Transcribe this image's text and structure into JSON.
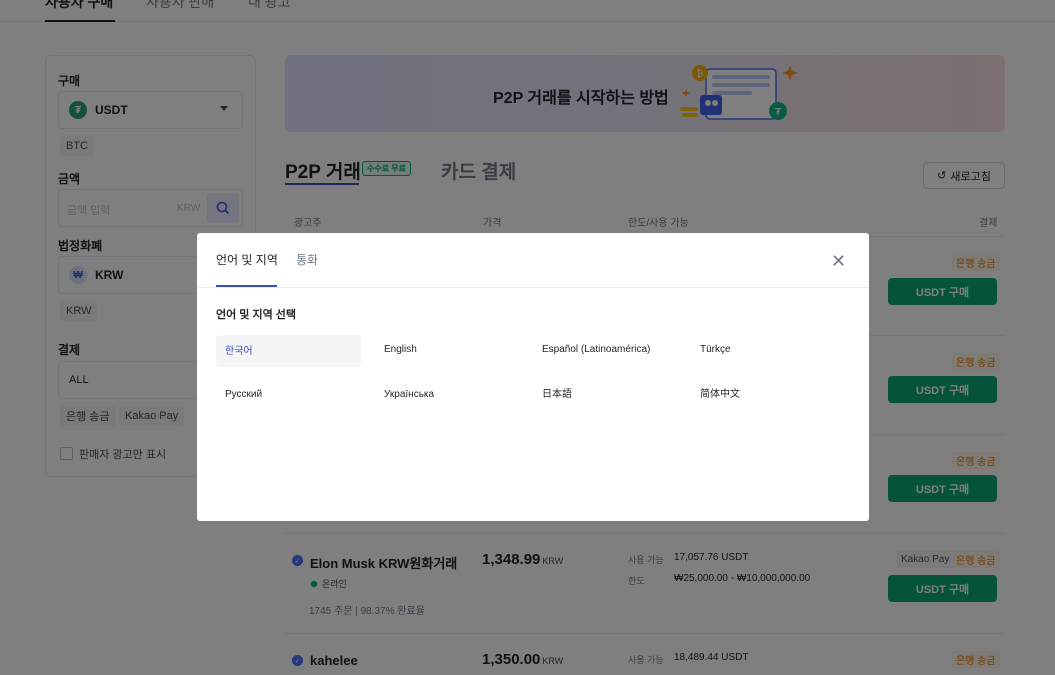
{
  "top_nav": {
    "tabs": [
      "사용자 구매",
      "사용자 판매",
      "내 광고"
    ]
  },
  "sidebar": {
    "buy_label": "구매",
    "buy_asset": "USDT",
    "buy_alt_chip": "BTC",
    "amount_label": "금액",
    "amount_placeholder": "금액 입력",
    "amount_unit": "KRW",
    "fiat_label": "법정화폐",
    "fiat_value": "KRW",
    "fiat_chip": "KRW",
    "payment_label": "결제",
    "payment_value": "ALL",
    "payment_chips": [
      "은행 송금",
      "Kakao Pay"
    ],
    "advertiser_only_label": "판매자 광고만 표시"
  },
  "banner": {
    "text": "P2P 거래를 시작하는 방법"
  },
  "main": {
    "tab_p2p": "P2P 거래",
    "free_badge": "수수료 무료",
    "tab_card": "카드 결제",
    "refresh_label": "새로고침",
    "columns": [
      "광고주",
      "가격",
      "한도/사용 가능",
      "결제"
    ],
    "buy_label": "USDT 구매",
    "bank_label": "은행 송금",
    "kakao_label": "Kakao Pay",
    "rows": [
      {
        "seller": "Elon Musk KRW원화거래",
        "status": "온라인",
        "stats": "1745 주문 | 98.37% 완료율",
        "price": "1,348.99",
        "currency": "KRW",
        "available_label": "사용 가능",
        "available": "17,057.76 USDT",
        "limit_label": "한도",
        "limit": "₩25,000.00 - ₩10,000,000.00"
      },
      {
        "seller": "kahelee",
        "price": "1,350.00",
        "currency": "KRW",
        "available_label": "사용 가능",
        "available": "18,489.44 USDT"
      }
    ]
  },
  "modal": {
    "tab_language": "언어 및 지역",
    "tab_currency": "통화",
    "section_title": "언어 및 지역 선택",
    "languages": [
      "한국어",
      "English",
      "Español (Latinoamérica)",
      "Türkçe",
      "Русский",
      "Українська",
      "日本語",
      "简体中文"
    ],
    "selected_index": 0
  },
  "colors": {
    "accent": "#3b4eb8",
    "buy_green": "#0ca678",
    "bank_orange": "#e67700"
  }
}
